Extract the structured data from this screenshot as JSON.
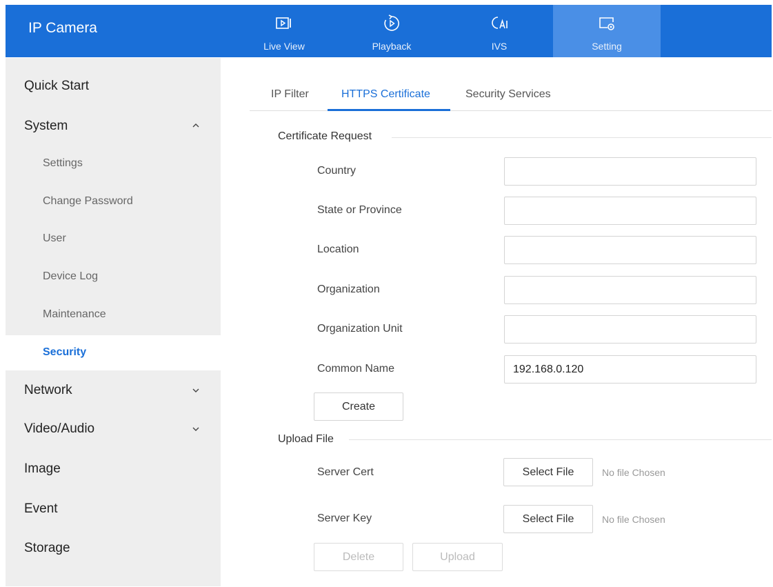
{
  "app": {
    "title": "IP Camera"
  },
  "top_nav": [
    {
      "label": "Live View",
      "icon": "live-view-icon"
    },
    {
      "label": "Playback",
      "icon": "playback-icon"
    },
    {
      "label": "IVS",
      "icon": "ivs-ai-icon"
    },
    {
      "label": "Setting",
      "icon": "setting-icon",
      "active": true
    }
  ],
  "sidebar": {
    "quick_start": "Quick Start",
    "system": "System",
    "system_sub": [
      "Settings",
      "Change Password",
      "User",
      "Device Log",
      "Maintenance",
      "Security"
    ],
    "active_sub": "Security",
    "network": "Network",
    "video_audio": "Video/Audio",
    "image": "Image",
    "event": "Event",
    "storage": "Storage"
  },
  "tabs": [
    {
      "label": "IP Filter"
    },
    {
      "label": "HTTPS Certificate",
      "active": true
    },
    {
      "label": "Security Services"
    }
  ],
  "cert_request": {
    "title": "Certificate Request",
    "fields": [
      {
        "label": "Country",
        "value": ""
      },
      {
        "label": "State or Province",
        "value": ""
      },
      {
        "label": "Location",
        "value": ""
      },
      {
        "label": "Organization",
        "value": ""
      },
      {
        "label": "Organization Unit",
        "value": ""
      },
      {
        "label": "Common Name",
        "value": "192.168.0.120"
      }
    ],
    "create_label": "Create"
  },
  "upload": {
    "title": "Upload File",
    "server_cert_label": "Server Cert",
    "server_key_label": "Server Key",
    "select_file_label": "Select File",
    "no_file_text": "No file Chosen",
    "delete_label": "Delete",
    "upload_label": "Upload"
  },
  "colors": {
    "accent": "#1a6fd8",
    "active_tab_bg": "#4a8fe6",
    "sidebar_bg": "#eeeeee"
  }
}
